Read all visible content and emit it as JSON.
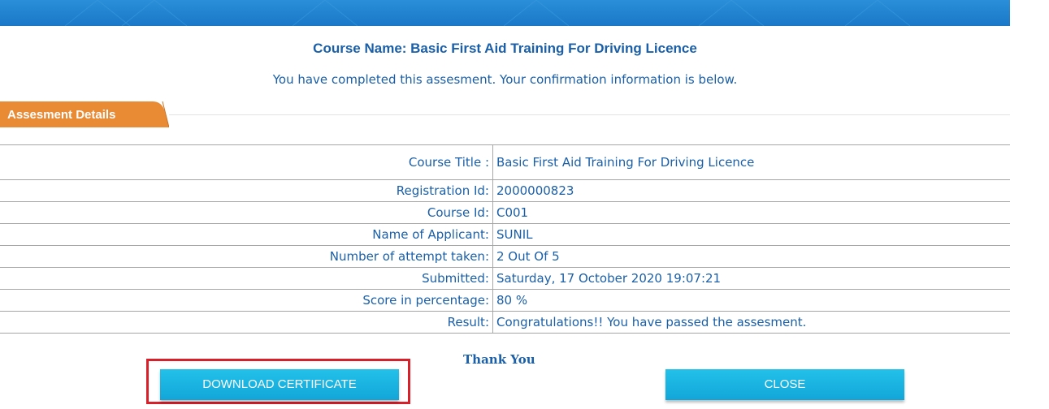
{
  "header": {
    "course_name": "Course Name: Basic First Aid Training For Driving Licence",
    "completed_message": "You have completed this assesment. Your confirmation information is below."
  },
  "section": {
    "tab_label": "Assesment Details"
  },
  "details": [
    {
      "label": "Course Title :",
      "value": "Basic First Aid Training For Driving Licence"
    },
    {
      "label": "Registration Id:",
      "value": "2000000823"
    },
    {
      "label": "Course Id:",
      "value": "C001"
    },
    {
      "label": "Name of Applicant:",
      "value": "SUNIL"
    },
    {
      "label": "Number of attempt taken:",
      "value": "2 Out Of 5"
    },
    {
      "label": "Submitted:",
      "value": "Saturday, 17 October 2020 19:07:21"
    },
    {
      "label": "Score in percentage:",
      "value": "80 %"
    },
    {
      "label": "Result:",
      "value": "Congratulations!! You have passed the assesment."
    }
  ],
  "footer": {
    "thank_you": "Thank You",
    "download_label": "DOWNLOAD CERTIFICATE",
    "close_label": "CLOSE"
  },
  "colors": {
    "banner": "#1a78c8",
    "text_blue": "#1a5fa8",
    "tab_orange": "#e98a35",
    "button_cyan": "#18b3e2",
    "highlight_red": "#d8202a"
  }
}
